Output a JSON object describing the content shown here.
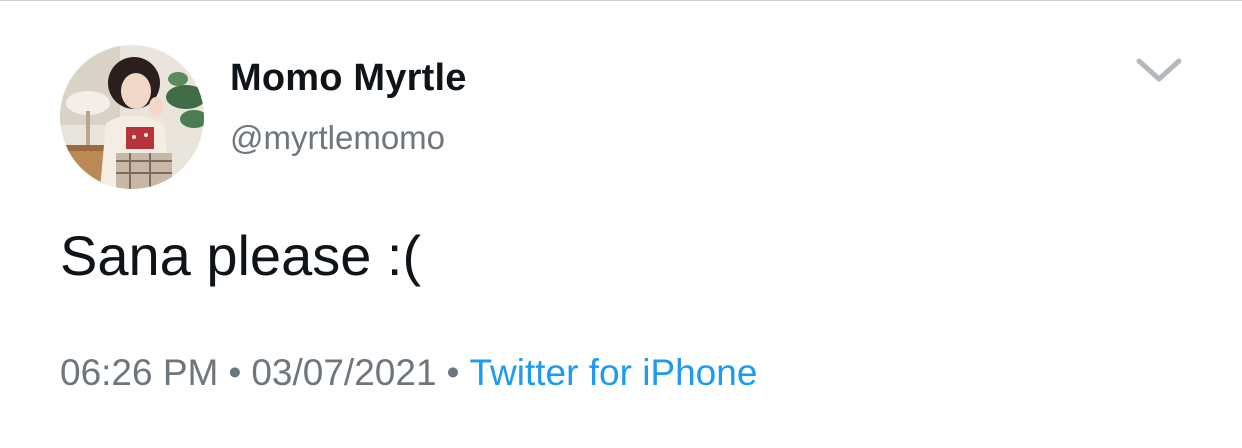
{
  "user": {
    "display_name": "Momo Myrtle",
    "handle": "@myrtlemomo",
    "avatar_icon": "profile-photo"
  },
  "tweet": {
    "text": "Sana please :(",
    "time": "06:26 PM",
    "date": "03/07/2021",
    "separator": "•",
    "source": "Twitter for iPhone"
  },
  "menu": {
    "icon": "chevron-down-icon"
  },
  "colors": {
    "text_primary": "#0f1419",
    "text_secondary": "#6e767d",
    "link": "#1d9bf0"
  }
}
